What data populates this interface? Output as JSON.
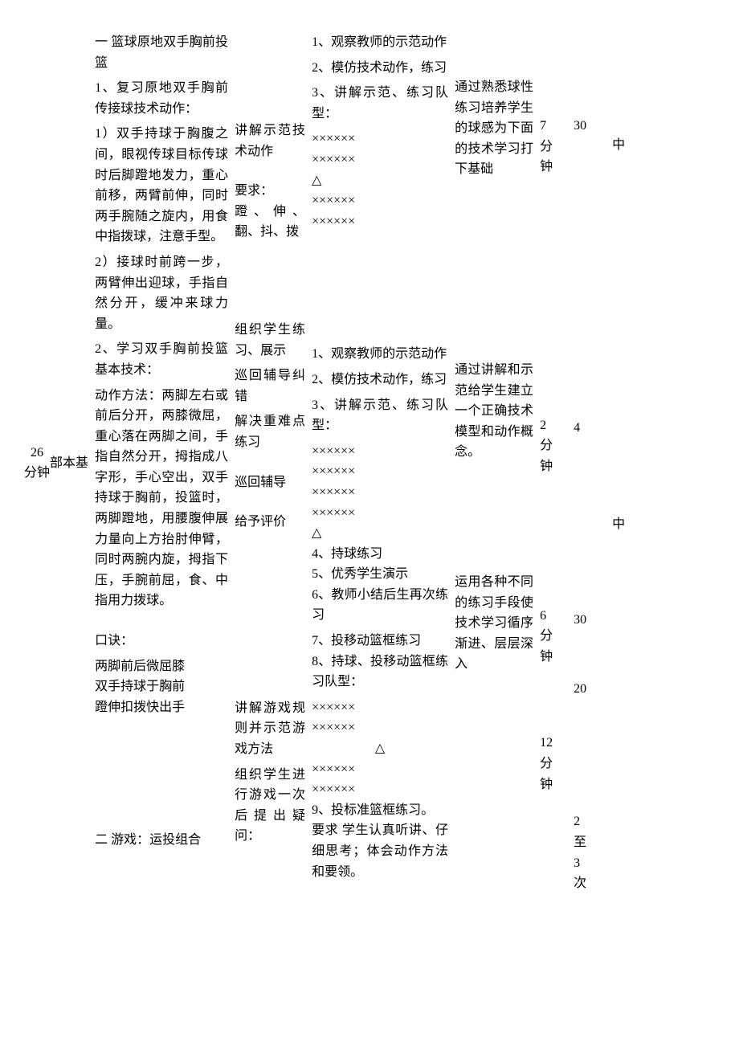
{
  "section": {
    "label1": "基",
    "label2": "本",
    "label3": "部",
    "duration": "26\n分钟"
  },
  "content": {
    "title1": "一 篮球原地双手胸前投篮",
    "r1": "1、复习原地双手胸前传接球技术动作：",
    "r1a": "1）双手持球于胸腹之间，眼视传球目标传球时后脚蹬地发力，重心前移，两臂前伸，同时两手腕随之旋内，用食中指拨球，注意手型。",
    "r1b": "2）接球时前跨一步，两臂伸出迎球，手指自然分开，缓冲来球力量。",
    "r2": "2、学习双手胸前投篮基本技术：",
    "r2a": "动作方法：两脚左右或前后分开，两膝微屈，重心落在两脚之间，手指自然分开，拇指成八字形，手心空出，双手持球于胸前，投篮时，两脚蹬地，用腰腹伸展力量向上方抬肘伸臂，同时两腕内旋，拇指下压，手腕前屈，食、中指用力拨球。",
    "kjHead": "口诀：",
    "kj1": "两脚前后微屈膝",
    "kj2": "双手持球于胸前",
    "kj3": "蹬伸扣拨快出手",
    "title2": "二 游戏：运投组合"
  },
  "teacher": {
    "t1": "讲解示范技术动作",
    "t2": "要求：",
    "t3": "蹬、伸、翻、抖、拨",
    "t4": "组织学生练习、展示",
    "t5": "巡回辅导纠错",
    "t6": "解决重难点练习",
    "t7": "巡回辅导",
    "t8": "给予评价",
    "t9": "讲解游戏规则并示范游戏方法",
    "t10": "组织学生进行游戏一次后提出疑问："
  },
  "student": {
    "s1": "1、观察教师的示范动作",
    "s2": "2、模仿技术动作，练习",
    "s3": "3、讲解示范、练习队型：",
    "row": "××××××",
    "tri": "△",
    "s4": "1、观察教师的示范动作",
    "s5": "2、模仿技术动作，练习",
    "s6": "3、讲解示范、练习队型：",
    "s7": "4、持球练习",
    "s8": "5、优秀学生演示",
    "s9": "6、教师小结后生再次练习",
    "s10": "7、投移动篮框练习",
    "s11": "8、持球、投移动篮框练习队型：",
    "s12": "9、投标准篮框练习。",
    "s13": "要求 学生认真听讲、仔细思考；体会动作方法和要领。"
  },
  "purpose": {
    "p1": "通过熟悉球性练习培养学生的球感为下面的技术学习打下基础",
    "p2": "通过讲解和示范给学生建立一个正确技术模型和动作概念。",
    "p3": "运用各种不同的练习手段使技术学习循序渐进、层层深入"
  },
  "time": {
    "t1": "7\n分\n钟",
    "t2": "2\n分\n钟",
    "t3": "6\n分\n钟",
    "t4": "12\n分\n钟"
  },
  "count": {
    "c1": "30",
    "c2": "4",
    "c3": "30",
    "c4": "20",
    "c5": "2\n至\n3\n次"
  },
  "level": {
    "l1": "中",
    "l2": "中"
  }
}
